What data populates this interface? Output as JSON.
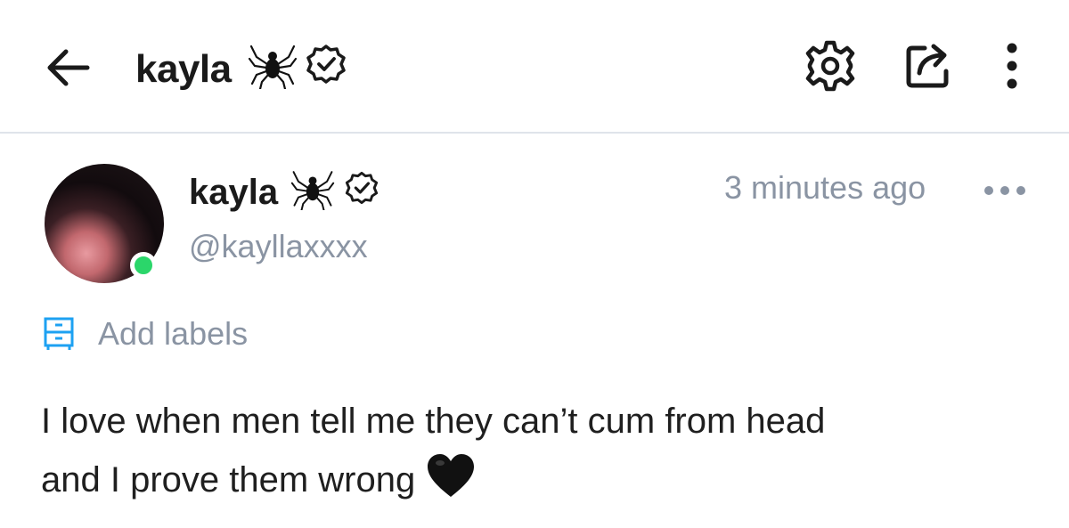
{
  "header": {
    "title": "kayla",
    "back_icon": "arrow-left-icon",
    "settings_icon": "gear-icon",
    "share_icon": "share-icon",
    "menu_icon": "kebab-menu-icon"
  },
  "post": {
    "author_name": "kayla",
    "author_handle": "@kayllaxxxx",
    "timestamp": "3 minutes ago",
    "online": true,
    "online_color": "#2bd66a",
    "verified": true,
    "labels_action": "Add labels",
    "labels_color": "#1da1f2",
    "text_line1": "I love when men tell me they can’t cum from head",
    "text_line2": "and I prove them wrong"
  },
  "colors": {
    "muted_text": "#8a94a3",
    "divider": "#dfe4ea"
  }
}
